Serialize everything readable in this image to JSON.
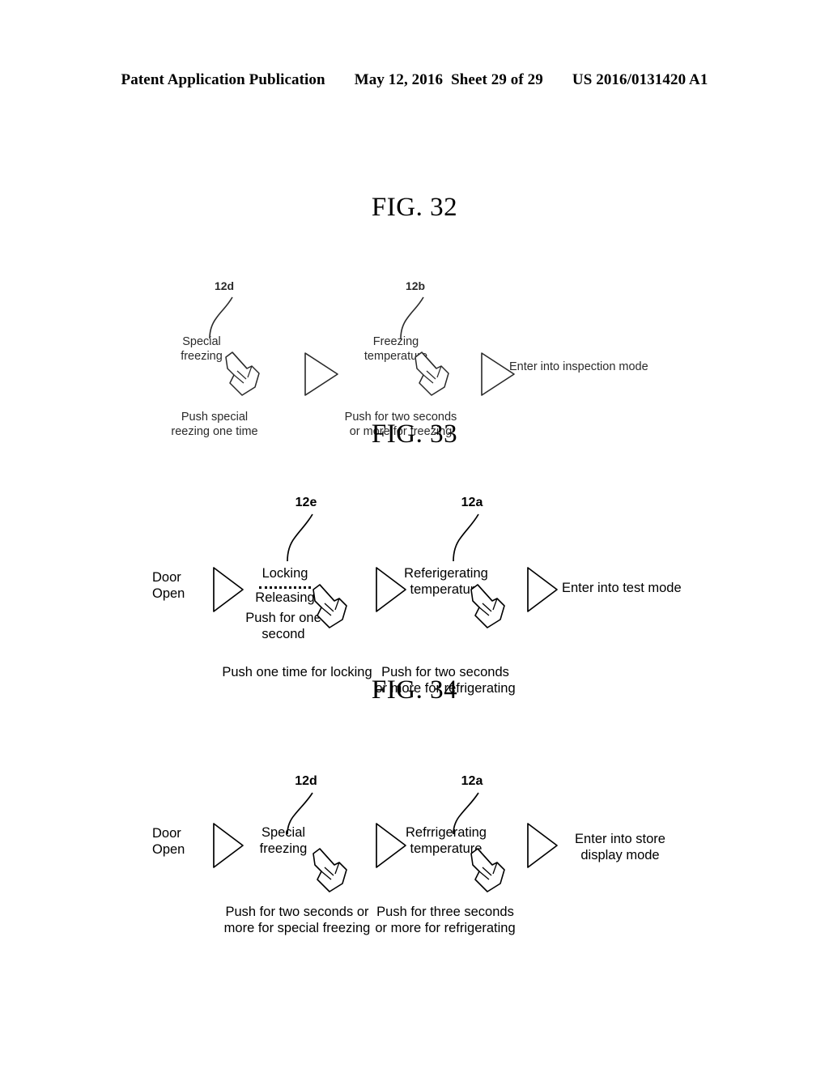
{
  "header": {
    "publication": "Patent Application Publication",
    "date": "May 12, 2016",
    "sheet": "Sheet 29 of 29",
    "docnum": "US 2016/0131420 A1"
  },
  "figures": [
    {
      "id": "fig32",
      "title": "FIG. 32",
      "ref_labels": [
        {
          "name": "ref-12d",
          "text": "12d"
        },
        {
          "name": "ref-12b",
          "text": "12b"
        }
      ],
      "steps": [
        {
          "name": "special-freezing",
          "button_label": "Special\nfreezing",
          "caption": "Push special\nreezing one time",
          "has_hand": true,
          "icon": "pointing-hand-icon"
        },
        {
          "name": "freezing-temperature",
          "button_label": "Freezing\ntemperature",
          "caption": "Push for two seconds\nor more for freezing",
          "has_hand": true,
          "icon": "pointing-hand-icon"
        }
      ],
      "result": "Enter into inspection mode",
      "arrows": [
        "arrow-right-icon",
        "arrow-right-icon"
      ]
    },
    {
      "id": "fig33",
      "title": "FIG. 33",
      "start_label": "Door\nOpen",
      "ref_labels": [
        {
          "name": "ref-12e",
          "text": "12e"
        },
        {
          "name": "ref-12a",
          "text": "12a"
        }
      ],
      "steps": [
        {
          "name": "locking-releasing",
          "button_label_top": "Locking",
          "button_label_bottom": "Releasing",
          "sub_label": "Push for one\nsecond",
          "caption": "Push one time for locking",
          "has_hand": true,
          "icon": "pointing-hand-icon"
        },
        {
          "name": "referigerating-temperature",
          "button_label": "Referigerating\ntemperature",
          "caption": "Push for two seconds\nor more for refrigerating",
          "has_hand": true,
          "icon": "pointing-hand-icon"
        }
      ],
      "result": "Enter into test mode",
      "arrows": [
        "arrow-right-icon",
        "arrow-right-icon",
        "arrow-right-icon"
      ]
    },
    {
      "id": "fig34",
      "title": "FIG. 34",
      "start_label": "Door\nOpen",
      "ref_labels": [
        {
          "name": "ref-12d",
          "text": "12d"
        },
        {
          "name": "ref-12a",
          "text": "12a"
        }
      ],
      "steps": [
        {
          "name": "special-freezing",
          "button_label": "Special\nfreezing",
          "caption": "Push for two seconds or\nmore for special freezing",
          "has_hand": true,
          "icon": "pointing-hand-icon"
        },
        {
          "name": "refrrigerating-temperature",
          "button_label": "Refrrigerating\ntemperature",
          "caption": "Push for three seconds\nor more for refrigerating",
          "has_hand": true,
          "icon": "pointing-hand-icon"
        }
      ],
      "result": "Enter into store\ndisplay mode",
      "arrows": [
        "arrow-right-icon",
        "arrow-right-icon",
        "arrow-right-icon"
      ]
    }
  ],
  "colors": {
    "ink": "#000000",
    "scan_gray": "#2a2a2a",
    "paper": "#ffffff"
  }
}
